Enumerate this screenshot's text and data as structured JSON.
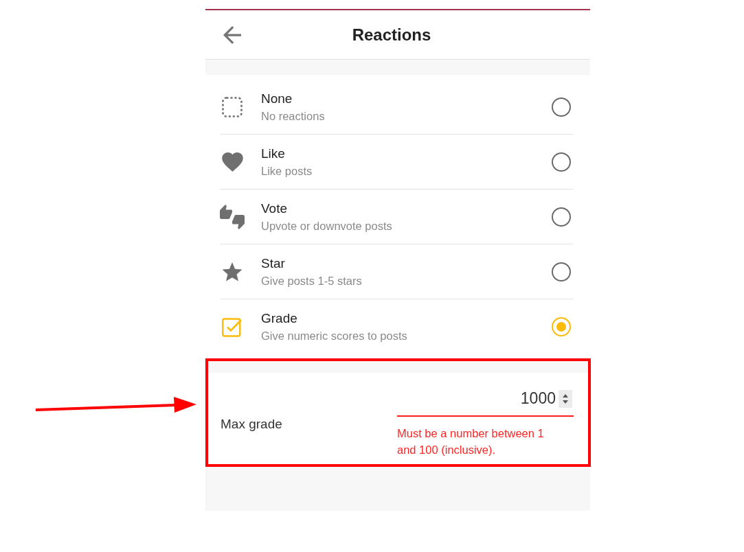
{
  "header": {
    "title": "Reactions"
  },
  "options": [
    {
      "kind": "none",
      "title": "None",
      "subtitle": "No reactions",
      "selected": false
    },
    {
      "kind": "like",
      "title": "Like",
      "subtitle": "Like posts",
      "selected": false
    },
    {
      "kind": "vote",
      "title": "Vote",
      "subtitle": "Upvote or downvote posts",
      "selected": false
    },
    {
      "kind": "star",
      "title": "Star",
      "subtitle": "Give posts 1-5 stars",
      "selected": false
    },
    {
      "kind": "grade",
      "title": "Grade",
      "subtitle": "Give numeric scores to posts",
      "selected": true
    }
  ],
  "max_grade": {
    "label": "Max grade",
    "value": "1000",
    "invalid": true,
    "error": "Must be a number between 1 and 100 (inclusive)."
  }
}
